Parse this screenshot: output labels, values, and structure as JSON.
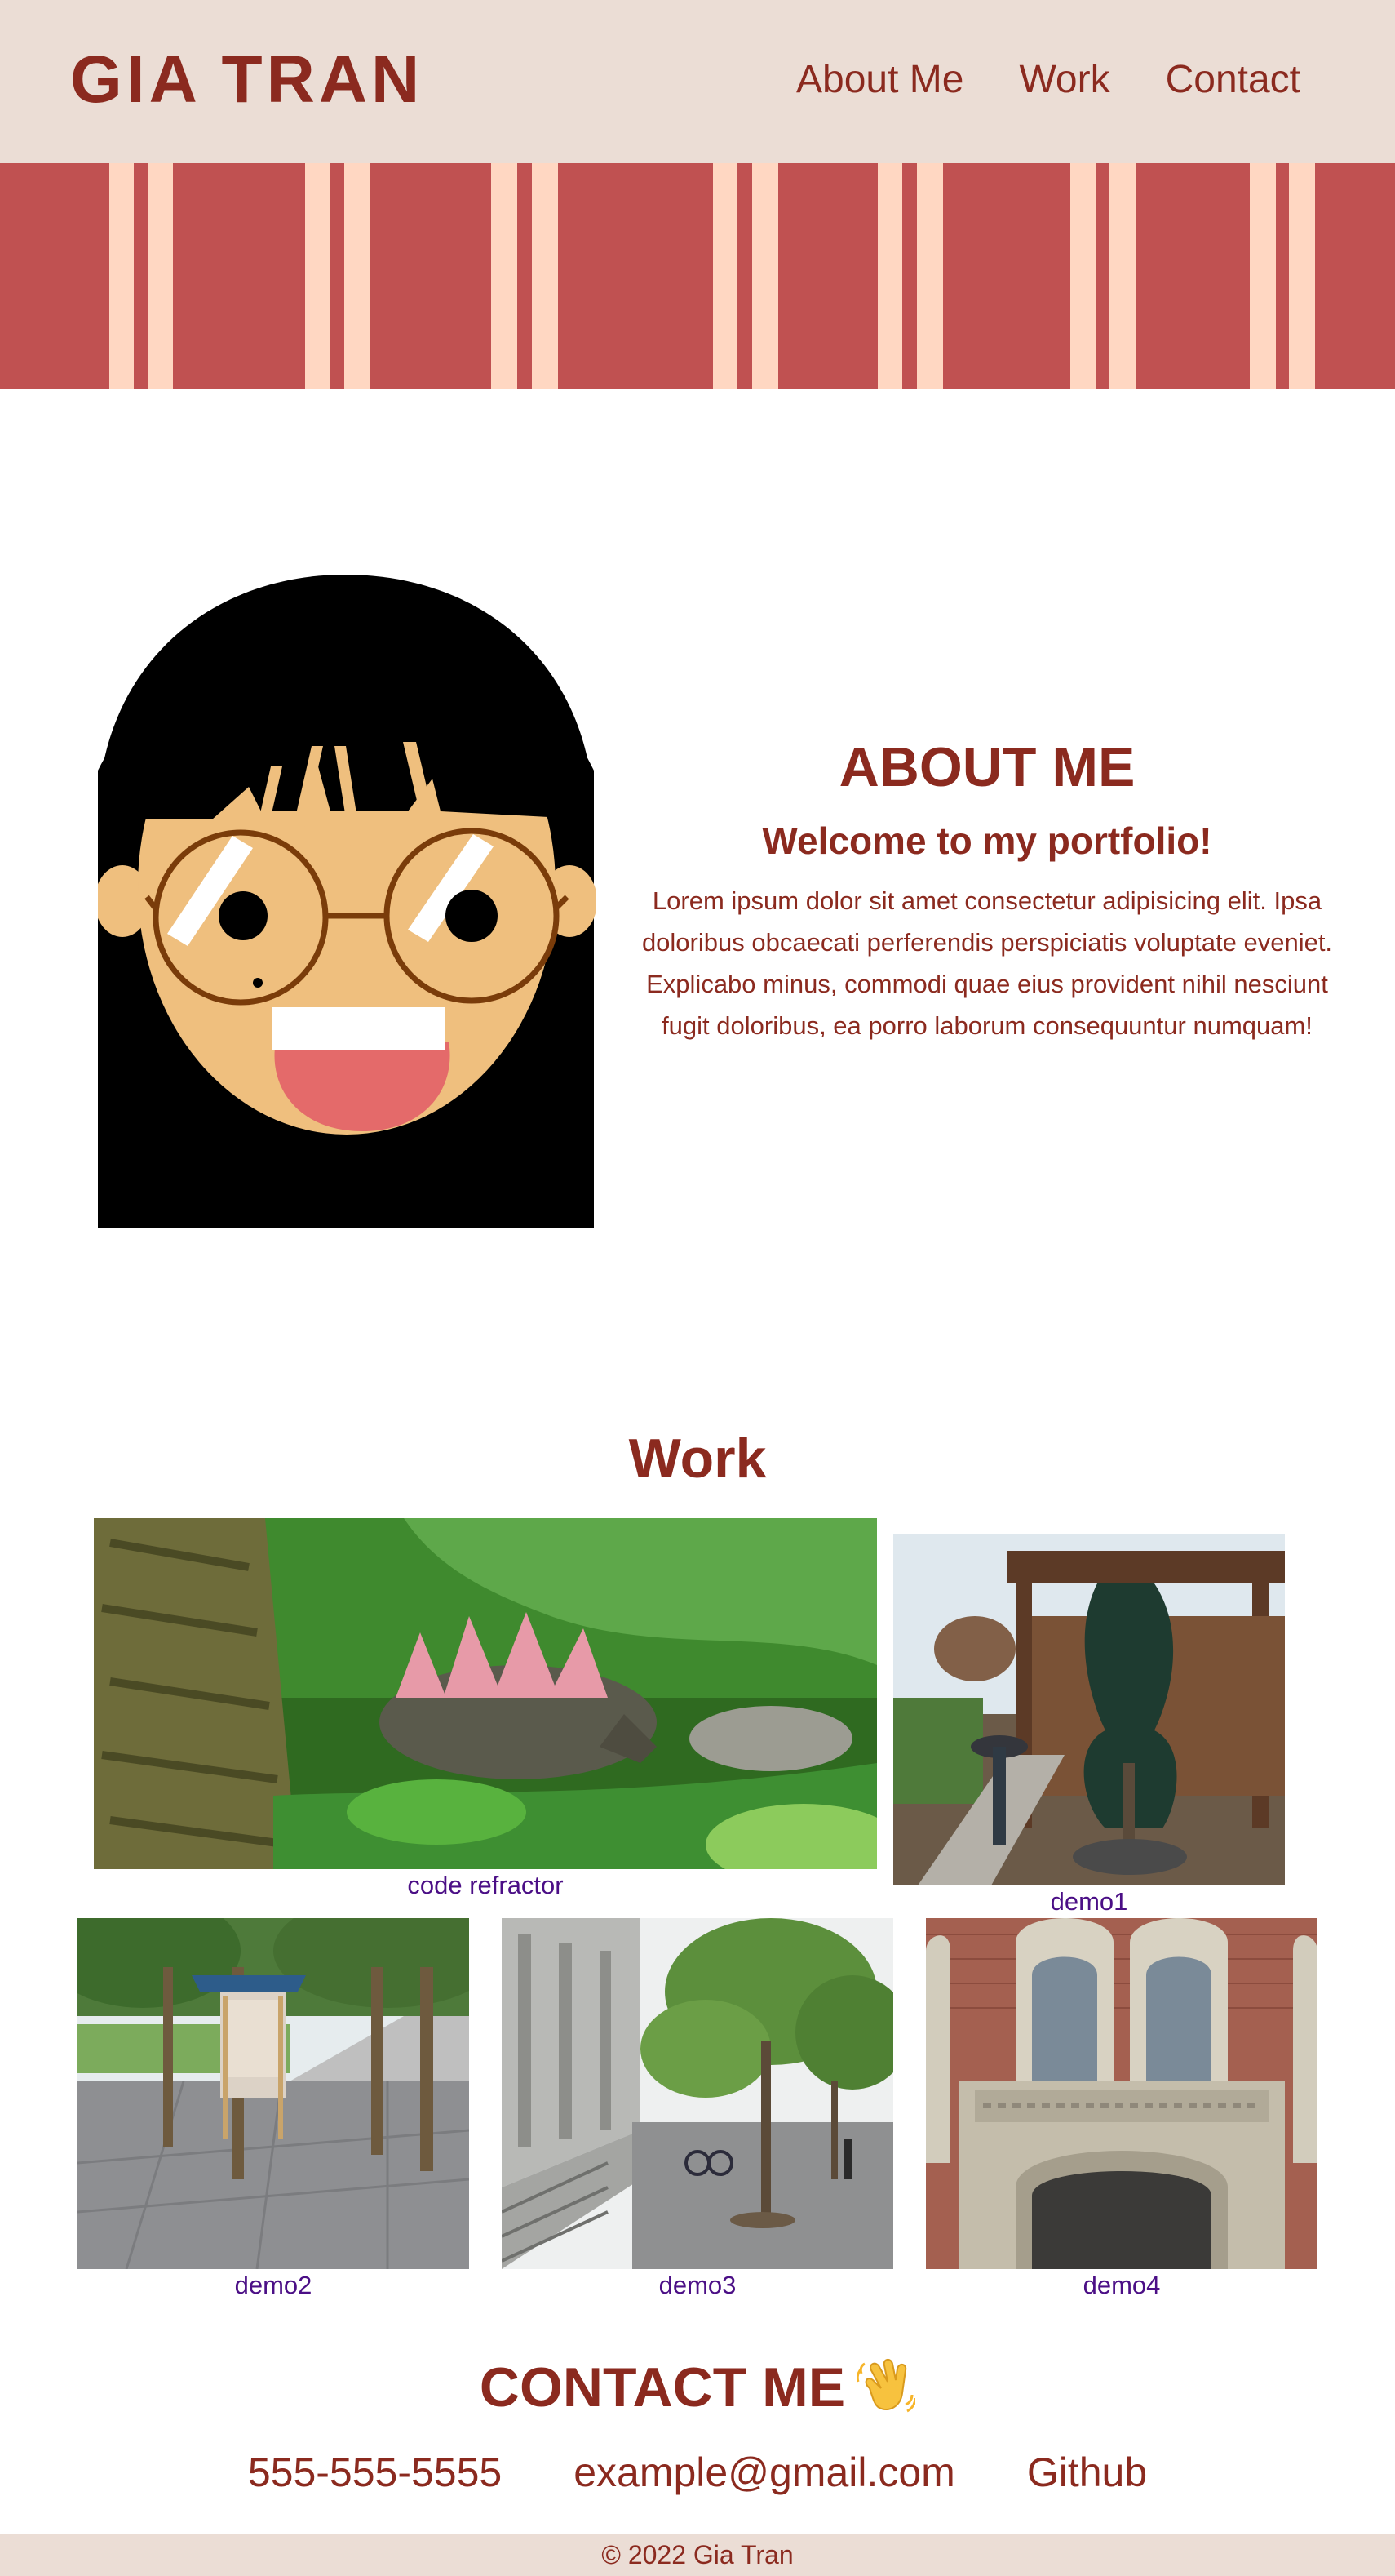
{
  "header": {
    "brand": "GIA TRAN",
    "nav": [
      "About Me",
      "Work",
      "Contact"
    ]
  },
  "about": {
    "title": "ABOUT ME",
    "subtitle": "Welcome to my portfolio!",
    "text": "Lorem ipsum dolor sit amet consectetur adipisicing elit. Ipsa doloribus obcaecati perferendis perspiciatis voluptate eveniet. Explicabo minus, commodi quae eius provident nihil nesciunt fugit doloribus, ea porro laborum consequuntur numquam!"
  },
  "work": {
    "title": "Work",
    "projects": [
      {
        "caption": "code refractor"
      },
      {
        "caption": "demo1"
      },
      {
        "caption": "demo2"
      },
      {
        "caption": "demo3"
      },
      {
        "caption": "demo4"
      }
    ]
  },
  "contact": {
    "title": "CONTACT ME",
    "links": [
      "555-555-5555",
      "example@gmail.com",
      "Github"
    ]
  },
  "footer": {
    "text": "© 2022 Gia Tran"
  },
  "colors": {
    "brand": "#8b2a1f",
    "header_bg": "#ebddd5",
    "banner": "#c05151",
    "banner_stripe": "#ffd7c2",
    "link_caption": "#4b0f86"
  },
  "icons": {
    "wave": "waving-hand-icon"
  }
}
